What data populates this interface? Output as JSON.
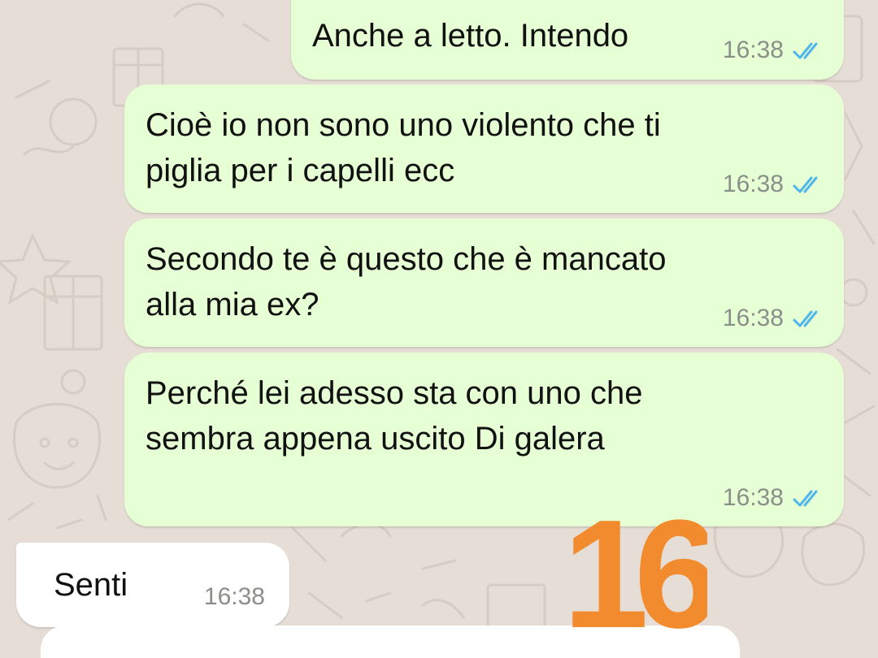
{
  "chat": {
    "messages": [
      {
        "direction": "outgoing",
        "text": "Anche a letto. Intendo",
        "time": "16:38",
        "status": "read"
      },
      {
        "direction": "outgoing",
        "text": "Cioè io non sono uno violento che ti\npiglia per i capelli ecc",
        "time": "16:38",
        "status": "read"
      },
      {
        "direction": "outgoing",
        "text": "Secondo te è questo che è mancato\nalla mia ex?",
        "time": "16:38",
        "status": "read"
      },
      {
        "direction": "outgoing",
        "text": "Perché lei adesso sta con uno che\nsembra appena uscito Di galera",
        "time": "16:38",
        "status": "read"
      },
      {
        "direction": "incoming",
        "text": "Senti",
        "time": "16:38"
      }
    ]
  },
  "overlay": {
    "number": "16",
    "color": "#f28a2e"
  },
  "icons": {
    "read_receipt": "double-check-icon"
  },
  "colors": {
    "chat_background": "#e6ded6",
    "outgoing_bubble": "#e6ffd4",
    "incoming_bubble": "#ffffff",
    "read_tick": "#4fb6ec",
    "time_text": "#8a8f8a"
  }
}
